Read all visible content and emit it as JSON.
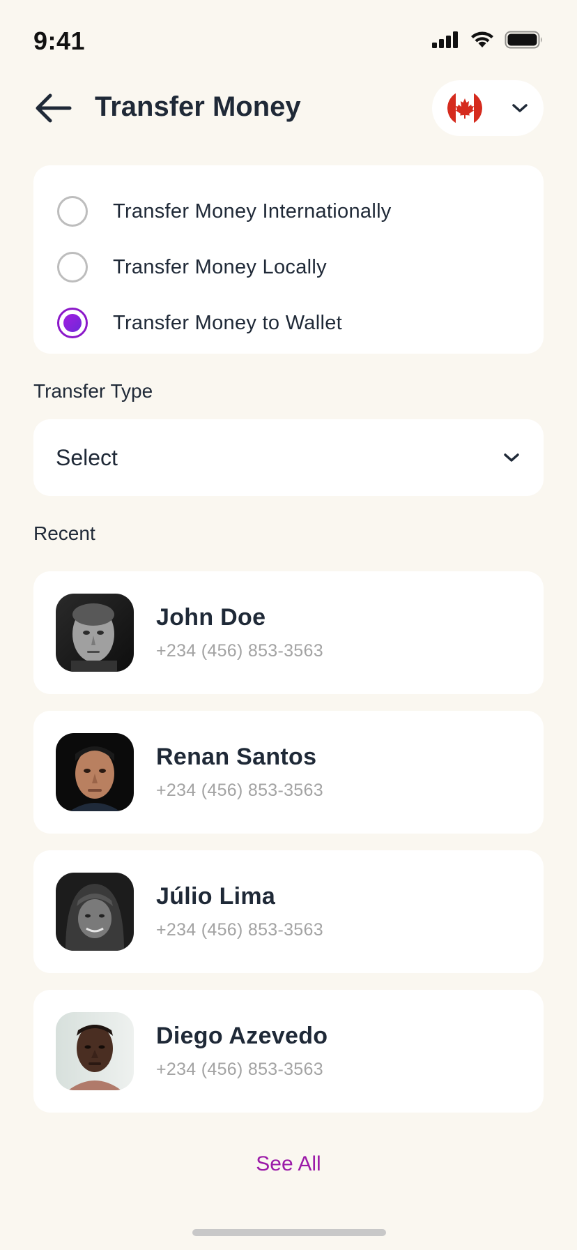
{
  "status_bar": {
    "time": "9:41"
  },
  "header": {
    "back_icon": "arrow-left-icon",
    "title": "Transfer Money",
    "country": {
      "flag_icon": "canada-flag-icon",
      "chevron_icon": "chevron-down-icon"
    }
  },
  "transfer_options": [
    {
      "label": "Transfer Money Internationally",
      "selected": false
    },
    {
      "label": "Transfer Money Locally",
      "selected": false
    },
    {
      "label": "Transfer Money to Wallet",
      "selected": true
    }
  ],
  "transfer_type": {
    "label": "Transfer Type",
    "value": "Select"
  },
  "recent": {
    "label": "Recent",
    "contacts": [
      {
        "name": "John Doe",
        "phone": "+234 (456) 853-3563"
      },
      {
        "name": "Renan Santos",
        "phone": "+234 (456) 853-3563"
      },
      {
        "name": "Júlio Lima",
        "phone": "+234 (456) 853-3563"
      },
      {
        "name": "Diego Azevedo",
        "phone": "+234 (456) 853-3563"
      }
    ],
    "see_all_label": "See All"
  },
  "colors": {
    "background": "#faf7f0",
    "card": "#ffffff",
    "accent": "#8b18c9",
    "link": "#9b1aa8",
    "muted_text": "#a3a3a3"
  }
}
